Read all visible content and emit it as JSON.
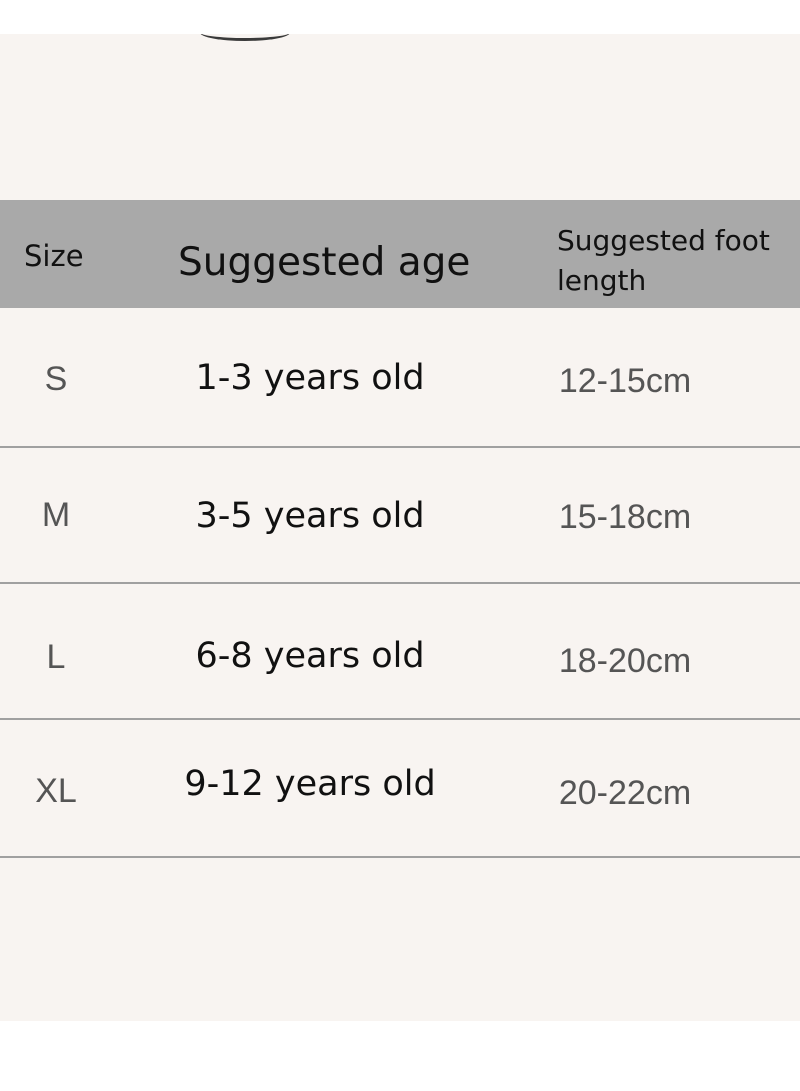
{
  "table": {
    "header": {
      "size": "Size",
      "age": "Suggested age",
      "foot_length": "Suggested foot length"
    },
    "rows": [
      {
        "size": "S",
        "age": "1-3 years old",
        "foot_length": "12-15cm"
      },
      {
        "size": "M",
        "age": "3-5 years old",
        "foot_length": "15-18cm"
      },
      {
        "size": "L",
        "age": "6-8 years old",
        "foot_length": "18-20cm"
      },
      {
        "size": "XL",
        "age": "9-12 years old",
        "foot_length": "20-22cm"
      }
    ]
  },
  "colors": {
    "background": "#f8f4f1",
    "header_background": "#a9a9a9",
    "divider": "#a0a0a0",
    "header_text": "#111111",
    "age_text": "#111111",
    "size_and_length_text": "#555555"
  }
}
